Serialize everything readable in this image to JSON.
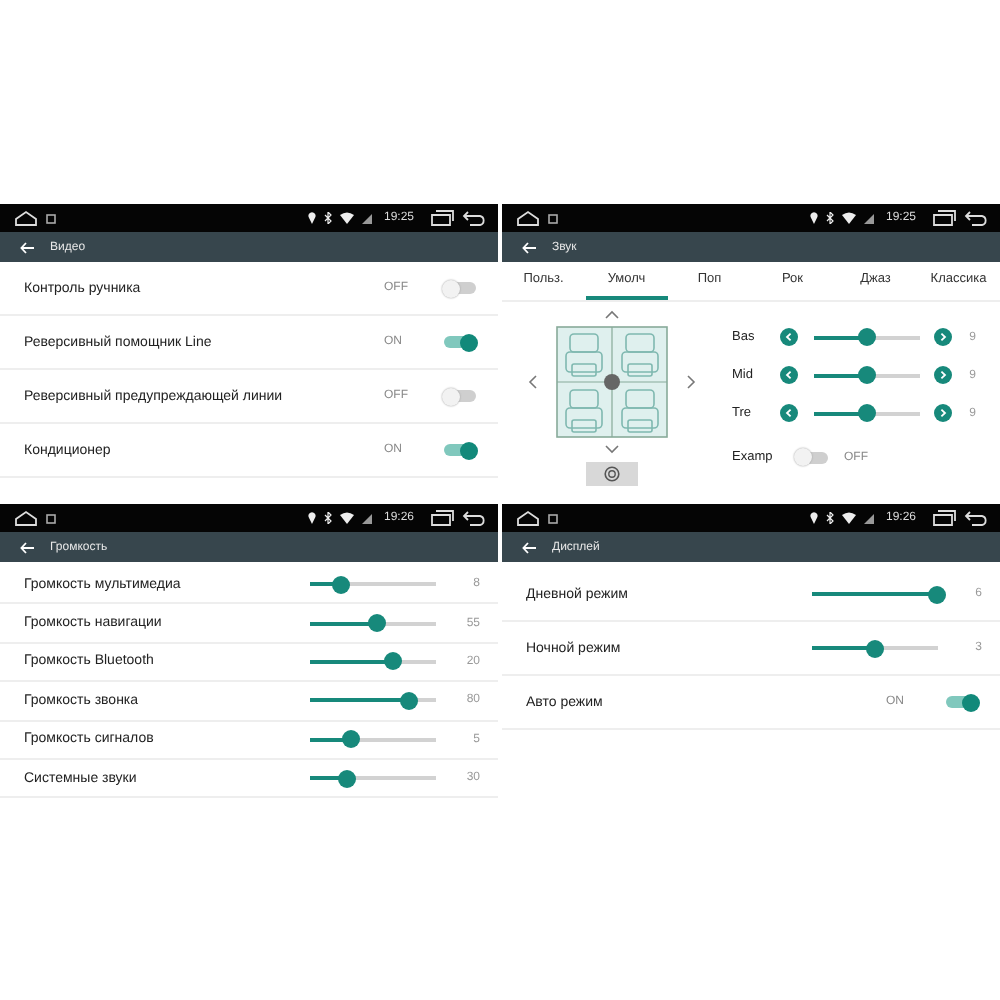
{
  "panels": [
    {
      "kind": "toggles",
      "time": "19:25",
      "title": "Видео",
      "rows": [
        {
          "kind": "toggle",
          "label": "Контроль ручника",
          "state_text": "OFF",
          "on": false
        },
        {
          "kind": "toggle",
          "label": "Реверсивный помощник Line",
          "state_text": "ON",
          "on": true
        },
        {
          "kind": "toggle",
          "label": "Реверсивный предупреждающей линии",
          "state_text": "OFF",
          "on": false
        },
        {
          "kind": "toggle",
          "label": "Кондиционер",
          "state_text": "ON",
          "on": true
        }
      ]
    },
    {
      "kind": "sound",
      "time": "19:25",
      "title": "Звук",
      "tabs": [
        {
          "label": "Польз.",
          "selected": false
        },
        {
          "label": "Умолч",
          "selected": true
        },
        {
          "label": "Поп",
          "selected": false
        },
        {
          "label": "Рок",
          "selected": false
        },
        {
          "label": "Джаз",
          "selected": false
        },
        {
          "label": "Классика",
          "selected": false
        }
      ],
      "bands": [
        {
          "label": "Bas",
          "level": 0.5,
          "value": "9"
        },
        {
          "label": "Mid",
          "level": 0.5,
          "value": "9"
        },
        {
          "label": "Tre",
          "level": 0.5,
          "value": "9"
        }
      ],
      "examp": {
        "label": "Examp",
        "state_text": "OFF",
        "on": false
      }
    },
    {
      "kind": "sliders",
      "time": "19:26",
      "title": "Громкость",
      "rows": [
        {
          "kind": "slider",
          "label": "Громкость мультимедиа",
          "level": 0.26,
          "value": "8"
        },
        {
          "kind": "slider",
          "label": "Громкость навигации",
          "level": 0.54,
          "value": "55"
        },
        {
          "kind": "slider",
          "label": "Громкость Bluetooth",
          "level": 0.67,
          "value": "20"
        },
        {
          "kind": "slider",
          "label": "Громкость звонка",
          "level": 0.8,
          "value": "80"
        },
        {
          "kind": "slider",
          "label": "Громкость сигналов",
          "level": 0.33,
          "value": "5"
        },
        {
          "kind": "slider",
          "label": "Системные звуки",
          "level": 0.3,
          "value": "30"
        }
      ]
    },
    {
      "kind": "display",
      "time": "19:26",
      "title": "Дисплей",
      "rows": [
        {
          "kind": "slider",
          "label": "Дневной режим",
          "level": 1,
          "value": "6"
        },
        {
          "kind": "slider",
          "label": "Ночной режим",
          "level": 0.5,
          "value": "3"
        },
        {
          "kind": "toggle",
          "label": "Авто режим",
          "state_text": "ON",
          "on": true
        }
      ]
    }
  ]
}
